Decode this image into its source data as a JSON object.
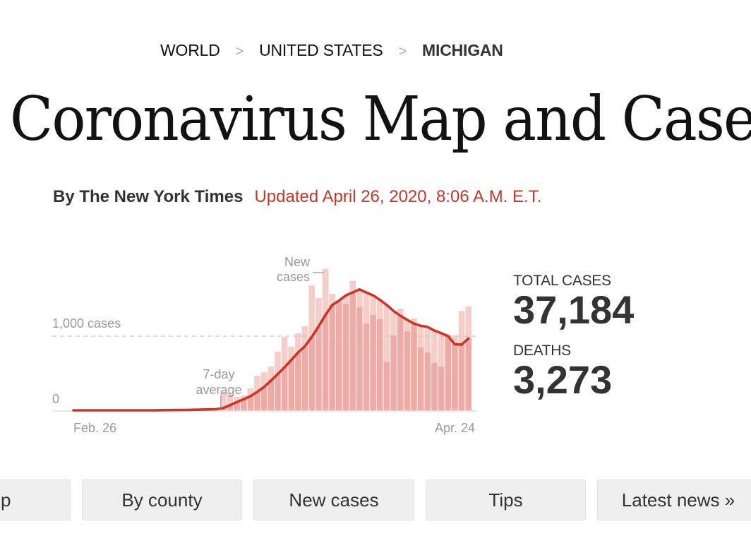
{
  "breadcrumb": {
    "items": [
      "WORLD",
      "UNITED STATES",
      "MICHIGAN"
    ],
    "separator": ">"
  },
  "title": "Coronavirus Map and Case",
  "byline": {
    "author": "By The New York Times",
    "updated": "Updated April 26, 2020, 8:06 A.M. E.T."
  },
  "stats": {
    "total_cases_label": "TOTAL CASES",
    "total_cases_value": "37,184",
    "deaths_label": "DEATHS",
    "deaths_value": "3,273"
  },
  "nav": {
    "buttons": [
      "p",
      "By county",
      "New cases",
      "Tips",
      "Latest news »"
    ]
  },
  "colors": {
    "accent_red": "#c0392b",
    "bar_fill": "#eeaaa4",
    "bar_fill_light": "#f5cdc9",
    "line": "#c8382a"
  },
  "chart_data": {
    "type": "bar",
    "title": "",
    "xlabel": "",
    "ylabel": "",
    "x_start": "Feb. 26",
    "x_end": "Apr. 24",
    "tick_labels": {
      "x": [
        "Feb. 26",
        "Apr. 24"
      ],
      "y": [
        "0",
        "1,000 cases"
      ]
    },
    "y_ticks": [
      0,
      1000
    ],
    "ylim": [
      0,
      1900
    ],
    "num_days": 59,
    "annotations": {
      "bars": "New cases",
      "line": "7-day average"
    },
    "grid": "dashed line at 1,000",
    "series": [
      {
        "name": "New cases",
        "type": "bar",
        "start_day_index": 22,
        "values": [
          250,
          220,
          180,
          200,
          295,
          465,
          515,
          590,
          790,
          990,
          860,
          1040,
          1135,
          1685,
          1515,
          1905,
          1570,
          1480,
          1440,
          1745,
          1390,
          1170,
          1285,
          1230,
          655,
          1010,
          1370,
          1065,
          1240,
          850,
          780,
          640,
          590,
          1025,
          1010,
          1340,
          1400
        ]
      },
      {
        "name": "7-day average",
        "type": "line",
        "values": [
          0,
          0,
          0,
          0,
          0,
          0,
          0,
          0,
          0,
          0,
          0,
          0,
          0,
          2,
          3,
          4,
          5,
          6,
          8,
          10,
          12,
          15,
          30,
          70,
          110,
          150,
          190,
          250,
          315,
          400,
          490,
          580,
          680,
          780,
          865,
          990,
          1130,
          1285,
          1420,
          1480,
          1550,
          1590,
          1630,
          1590,
          1550,
          1490,
          1420,
          1340,
          1275,
          1220,
          1170,
          1140,
          1125,
          1075,
          1040,
          1000,
          890,
          885,
          970
        ]
      }
    ]
  }
}
